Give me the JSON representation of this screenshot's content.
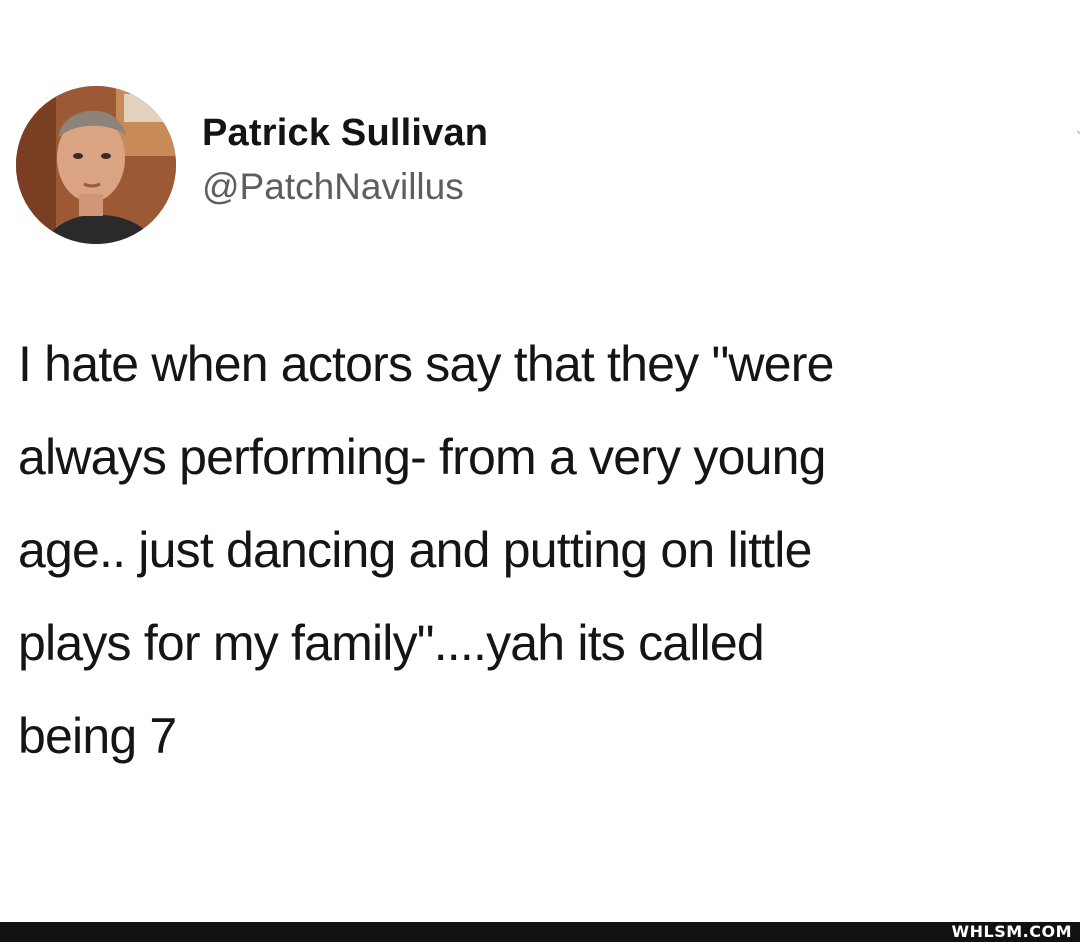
{
  "tweet": {
    "author_name": "Patrick Sullivan",
    "author_handle": "@PatchNavillus",
    "text": "I hate when actors say that they \"were\nalways performing- from a very young\nage.. just dancing and putting on little\nplays for my family\"....yah its called\nbeing 7"
  },
  "icons": {
    "avatar": "avatar-photo",
    "more": "chevron-down-icon"
  },
  "watermark": {
    "text": "WHLSM.COM"
  },
  "colors": {
    "background": "#ffffff",
    "text": "#151515",
    "handle": "#5e5e5e",
    "watermark_bar": "#111111"
  }
}
